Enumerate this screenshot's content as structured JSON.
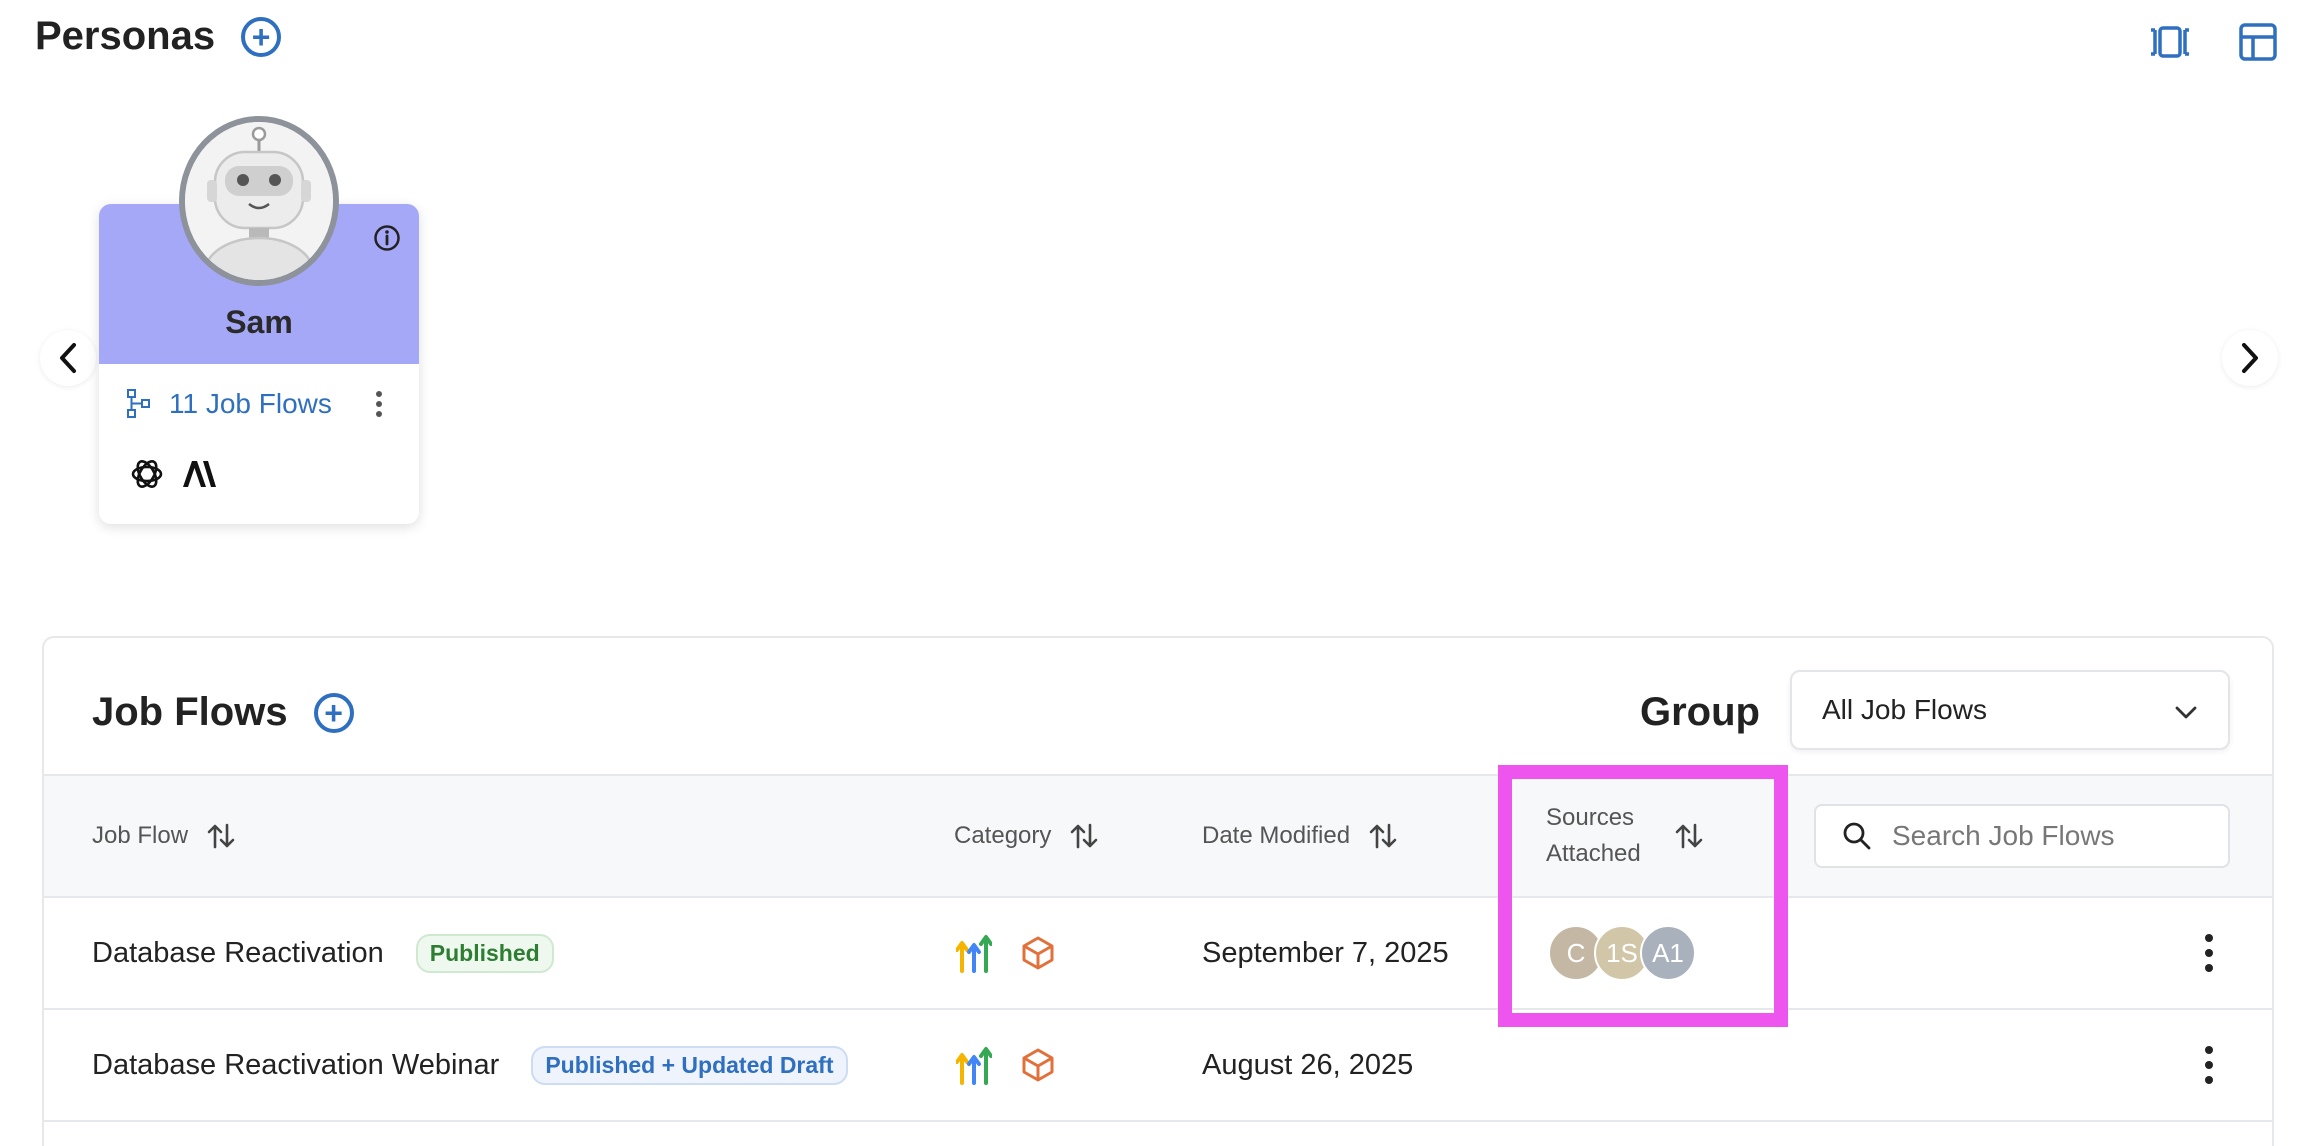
{
  "header": {
    "title": "Personas"
  },
  "persona": {
    "name": "Sam",
    "job_flows_label": "11 Job Flows"
  },
  "job_flows": {
    "title": "Job Flows",
    "group_label": "Group",
    "group_value": "All Job Flows",
    "search_placeholder": "Search Job Flows",
    "columns": {
      "job_flow": "Job Flow",
      "category": "Category",
      "date_modified": "Date Modified",
      "sources_attached": "Sources Attached"
    },
    "rows": [
      {
        "name": "Database Reactivation",
        "status": "Published",
        "date": "September 7, 2025",
        "sources": [
          "C",
          "1S",
          "A1"
        ]
      },
      {
        "name": "Database Reactivation Webinar",
        "status": "Published + Updated Draft",
        "date": "August 26, 2025",
        "sources": []
      }
    ]
  },
  "colors": {
    "accent": "#2f6fbf",
    "persona_card": "#a5a8f7",
    "highlight": "#ee55ee",
    "published_green": "#2e7d32",
    "source_c": "#c4b8a5",
    "source_1s": "#d2c6a8",
    "source_a1": "#a9b1bd"
  }
}
